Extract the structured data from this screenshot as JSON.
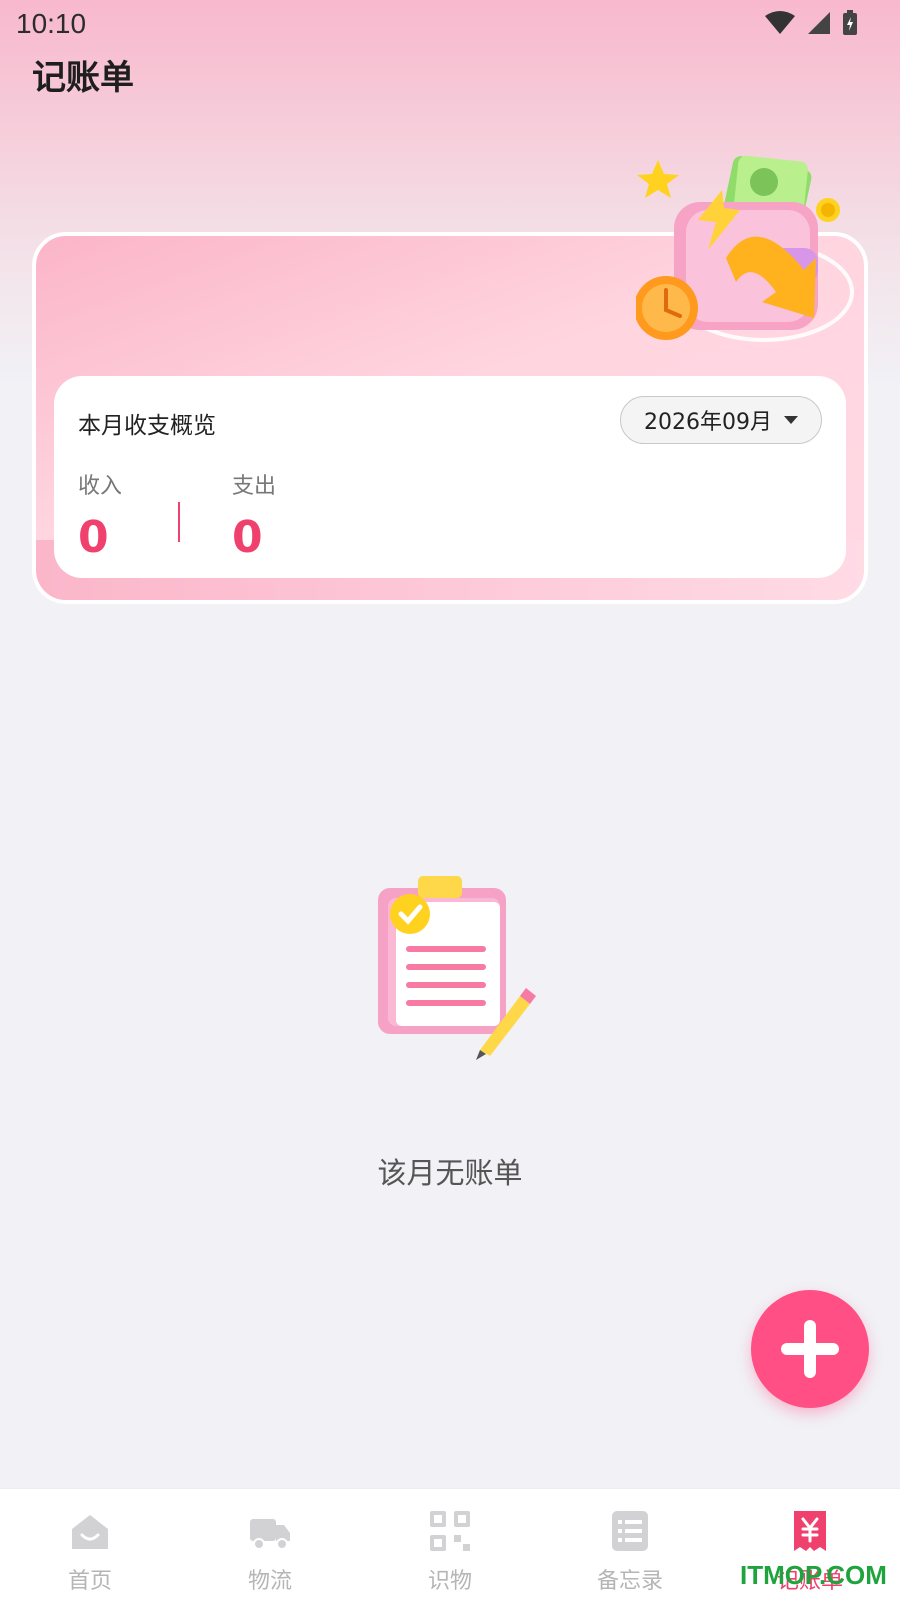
{
  "status_bar": {
    "time": "10:10"
  },
  "header": {
    "title": "记账单"
  },
  "summary": {
    "title": "本月收支概览",
    "month_selector": "2026年09月",
    "income_label": "收入",
    "income_value": "0",
    "expense_label": "支出",
    "expense_value": "0"
  },
  "empty_state": {
    "message": "该月无账单"
  },
  "fab": {
    "icon": "plus-icon"
  },
  "bottom_nav": {
    "items": [
      {
        "label": "首页",
        "icon": "home-icon"
      },
      {
        "label": "物流",
        "icon": "truck-icon"
      },
      {
        "label": "识物",
        "icon": "qr-scan-icon"
      },
      {
        "label": "备忘录",
        "icon": "memo-icon"
      },
      {
        "label": "记账单",
        "icon": "bill-icon",
        "active": true
      }
    ]
  },
  "watermark": "ITMOP.COM",
  "colors": {
    "accent": "#f0406e",
    "fab": "#ff4f85",
    "inactive": "#b5b5b5"
  }
}
